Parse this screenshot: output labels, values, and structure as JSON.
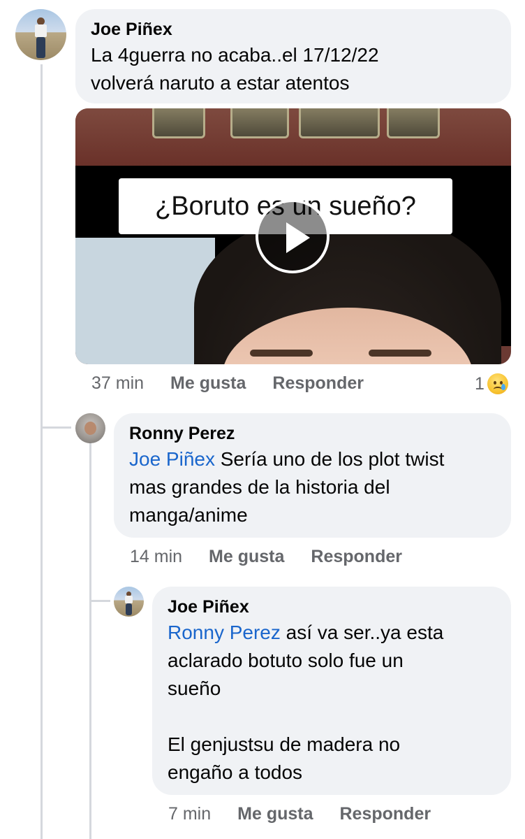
{
  "comments": [
    {
      "author": "Joe Piñex",
      "text_lines": [
        "La 4guerra no acaba..el 17/12/22",
        "volverá naruto a estar atentos"
      ],
      "video": {
        "caption": "¿Boruto es un sueño?"
      },
      "time": "37 min",
      "like_label": "Me gusta",
      "reply_label": "Responder",
      "reaction_count": "1",
      "reaction_icon": "sad-face-icon"
    },
    {
      "author": "Ronny Perez",
      "mention": "Joe Piñex",
      "text_lines": [
        "Sería uno de los plot twist",
        "mas grandes de la historia del",
        "manga/anime"
      ],
      "time": "14 min",
      "like_label": "Me gusta",
      "reply_label": "Responder"
    },
    {
      "author": "Joe Piñex",
      "mention": "Ronny Perez",
      "text_lines": [
        "así va ser..ya esta",
        "aclarado botuto solo fue un",
        "sueño",
        "",
        "El genjustsu de madera no",
        "engaño a todos"
      ],
      "time": "7 min",
      "like_label": "Me gusta",
      "reply_label": "Responder"
    }
  ],
  "colors": {
    "bubble": "#f0f2f5",
    "mention": "#1a66cc",
    "meta": "#65676b",
    "thread_line": "#d5d8dd"
  }
}
